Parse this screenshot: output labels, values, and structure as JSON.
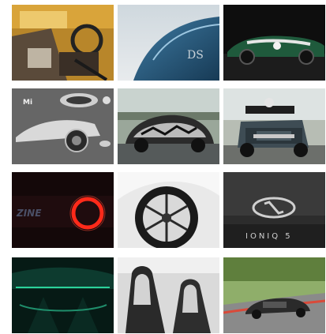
{
  "gallery": {
    "tiles": [
      {
        "subject": "race-car-interior",
        "label": ""
      },
      {
        "subject": "ds-car-rear-badge",
        "label": ""
      },
      {
        "subject": "green-vintage-race-car",
        "label": ""
      },
      {
        "subject": "concept-car-render",
        "label": ""
      },
      {
        "subject": "camouflaged-bmw-prototype",
        "label": ""
      },
      {
        "subject": "ford-f150-autonomous-test-truck",
        "label": ""
      },
      {
        "subject": "red-ring-light-detail",
        "label": ""
      },
      {
        "subject": "aero-wheel-closeup",
        "label": ""
      },
      {
        "subject": "hyundai-ioniq-5-badge",
        "label": "IONIQ 5"
      },
      {
        "subject": "green-ambient-lit-interior",
        "label": ""
      },
      {
        "subject": "sport-seats-interior",
        "label": ""
      },
      {
        "subject": "porsche-prototype-on-track",
        "label": ""
      }
    ]
  },
  "colors": {
    "background": "#ffffff"
  }
}
